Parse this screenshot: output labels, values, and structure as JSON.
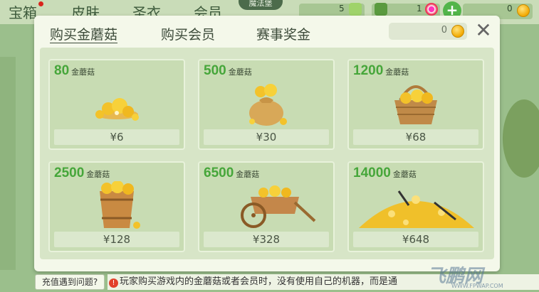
{
  "background": {
    "tabs": [
      "宝箱",
      "皮肤",
      "圣衣",
      "会员"
    ],
    "badge_label": "魔法堡",
    "res1_value": "5",
    "res2_value": "1",
    "res3_value": "0"
  },
  "dialog": {
    "tabs": [
      {
        "label": "购买金蘑菇",
        "active": true
      },
      {
        "label": "购买会员",
        "active": false
      },
      {
        "label": "赛事奖金",
        "active": false
      }
    ],
    "balance": "0",
    "unit_label": "金蘑菇",
    "packages": [
      {
        "amount": "80",
        "price": "¥6"
      },
      {
        "amount": "500",
        "price": "¥30"
      },
      {
        "amount": "1200",
        "price": "¥68"
      },
      {
        "amount": "2500",
        "price": "¥128"
      },
      {
        "amount": "6500",
        "price": "¥328"
      },
      {
        "amount": "14000",
        "price": "¥648"
      }
    ]
  },
  "footer": {
    "help_label": "充值遇到问题?",
    "notice_icon": "!",
    "notice_text": "玩家购买游戏内的金蘑菇或者会员时，没有使用自己的机器，而是通"
  },
  "watermark": {
    "text": "飞鹏网",
    "sub": "WWW.FPWAP.COM"
  },
  "colors": {
    "amount_green": "#46a63a",
    "accent_green": "#52b54a",
    "coin_gold": "#f2a900"
  }
}
